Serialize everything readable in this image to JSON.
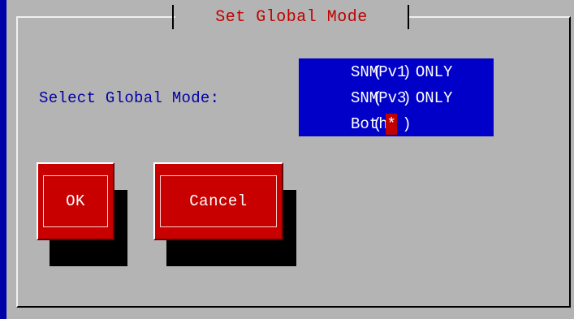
{
  "dialog": {
    "title": "Set Global Mode",
    "prompt_label": "Select Global Mode:"
  },
  "modes": [
    {
      "mark": " ",
      "label": "SNMPv1 ONLY",
      "selected": false
    },
    {
      "mark": " ",
      "label": "SNMPv3 ONLY",
      "selected": false
    },
    {
      "mark": "*",
      "label": "Both",
      "selected": true
    }
  ],
  "buttons": {
    "ok_label": "OK",
    "cancel_label": "Cancel"
  },
  "colors": {
    "background": "#0000a8",
    "dialog": "#b4b4b4",
    "title": "#c00000",
    "label": "#0000a8",
    "list_bg": "#0000c8",
    "button": "#c80000",
    "selection_mark": "#c00000"
  }
}
